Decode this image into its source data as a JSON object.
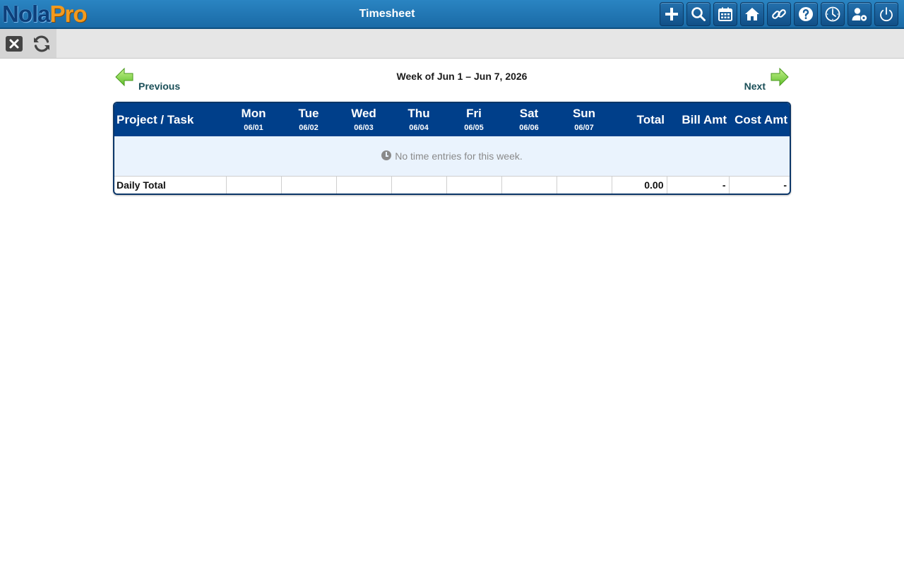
{
  "app": {
    "logo_part1": "Nola",
    "logo_part2": "Pro",
    "title": "Timesheet"
  },
  "toolbar_icons": [
    "plus-icon",
    "search-icon",
    "calendar-icon",
    "home-icon",
    "link-icon",
    "help-icon",
    "clock-icon",
    "user-settings-icon",
    "power-icon"
  ],
  "subbar_icons": [
    "close-icon",
    "refresh-icon"
  ],
  "nav": {
    "previous": "Previous",
    "next": "Next",
    "week": "Week of Jun 1 – Jun 7, 2026"
  },
  "table": {
    "project_header": "Project / Task",
    "days": [
      {
        "name": "Mon",
        "date": "06/01"
      },
      {
        "name": "Tue",
        "date": "06/02"
      },
      {
        "name": "Wed",
        "date": "06/03"
      },
      {
        "name": "Thu",
        "date": "06/04"
      },
      {
        "name": "Fri",
        "date": "06/05"
      },
      {
        "name": "Sat",
        "date": "06/06"
      },
      {
        "name": "Sun",
        "date": "06/07"
      }
    ],
    "total_header": "Total",
    "bill_header": "Bill Amt",
    "cost_header": "Cost Amt",
    "empty_message": "No time entries for this week.",
    "daily_total_label": "Daily Total",
    "daily_totals": [
      "",
      "",
      "",
      "",
      "",
      "",
      ""
    ],
    "grand_total": "0.00",
    "bill_total": "-",
    "cost_total": "-"
  },
  "colors": {
    "topbar": "#1f78b8",
    "table_header": "#003f8a",
    "empty_row_bg": "#eaf3fd",
    "nav_arrow": "#7ed957"
  }
}
